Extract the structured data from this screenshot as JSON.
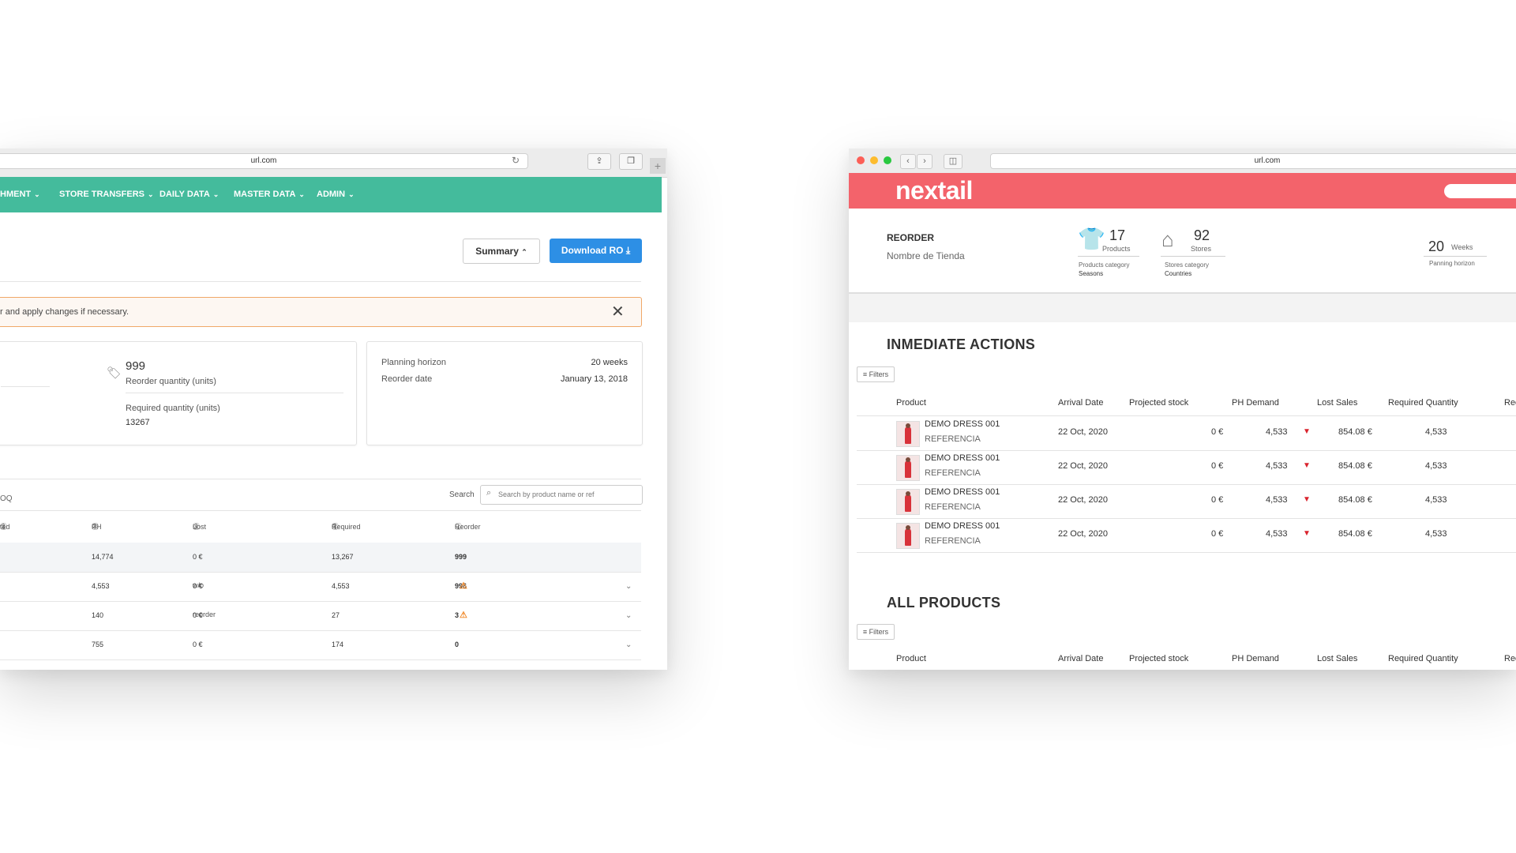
{
  "left": {
    "url": "url.com",
    "nav": [
      {
        "label": "HMENT"
      },
      {
        "label": "STORE TRANSFERS"
      },
      {
        "label": "DAILY DATA"
      },
      {
        "label": "MASTER DATA"
      },
      {
        "label": "ADMIN"
      }
    ],
    "summary_button": "Summary",
    "download_button": "Download RO",
    "alert_text": "r and apply changes if necessary.",
    "card1": {
      "reorder_value": "999",
      "reorder_label": "Reorder quantity (units)",
      "required_label": "Required quantity (units)",
      "required_value": "13267"
    },
    "card2": {
      "planning_label": "Planning horizon",
      "planning_value": "20 weeks",
      "reorder_date_label": "Reorder date",
      "reorder_date_value": "January 13, 2018"
    },
    "table": {
      "left_label": "OQ",
      "search_label": "Search",
      "search_placeholder": "Search by product name or ref",
      "headers": [
        "ted stock",
        "PH Demand",
        "Lost sales w/o reorder",
        "Required quantity",
        "Reorder quantity"
      ],
      "rows": [
        {
          "ph": "14,774",
          "lost": "0 €",
          "req": "13,267",
          "reorder": "999",
          "warn": false
        },
        {
          "ph": "4,553",
          "lost": "0 €",
          "req": "4,553",
          "reorder": "996",
          "warn": true
        },
        {
          "ph": "140",
          "lost": "0 €",
          "req": "27",
          "reorder": "3",
          "warn": true
        },
        {
          "ph": "755",
          "lost": "0 €",
          "req": "174",
          "reorder": "0",
          "warn": false
        }
      ]
    }
  },
  "right": {
    "url": "url.com",
    "logo": "nextail",
    "title": "REORDER",
    "store": "Nombre de Tienda",
    "products": {
      "value": "17",
      "label": "Products",
      "cat_label": "Products category",
      "cat_value": "Seasons"
    },
    "stores": {
      "value": "92",
      "label": "Stores",
      "cat_label": "Stores category",
      "cat_value": "Countries"
    },
    "horizon": {
      "value": "20",
      "unit": "Weeks",
      "label": "Panning horizon"
    },
    "section1": "INMEDIATE  ACTIONS",
    "section2": "ALL PRODUCTS",
    "filters": "Filters",
    "headers": {
      "product": "Product",
      "arrival": "Arrival Date",
      "projected": "Projected stock",
      "ph": "PH Demand",
      "lost": "Lost  Sales",
      "required": "Required Quantity",
      "extra": "Rec"
    },
    "rows": [
      {
        "name": "DEMO DRESS 001",
        "ref": "REFERENCIA",
        "arrival": "22 Oct, 2020",
        "projected": "0 €",
        "ph": "4,533",
        "lost": "854.08 €",
        "required": "4,533"
      },
      {
        "name": "DEMO DRESS 001",
        "ref": "REFERENCIA",
        "arrival": "22 Oct, 2020",
        "projected": "0 €",
        "ph": "4,533",
        "lost": "854.08 €",
        "required": "4,533"
      },
      {
        "name": "DEMO DRESS 001",
        "ref": "REFERENCIA",
        "arrival": "22 Oct, 2020",
        "projected": "0 €",
        "ph": "4,533",
        "lost": "854.08 €",
        "required": "4,533"
      },
      {
        "name": "DEMO DRESS 001",
        "ref": "REFERENCIA",
        "arrival": "22 Oct, 2020",
        "projected": "0 €",
        "ph": "4,533",
        "lost": "854.08 €",
        "required": "4,533"
      }
    ]
  }
}
